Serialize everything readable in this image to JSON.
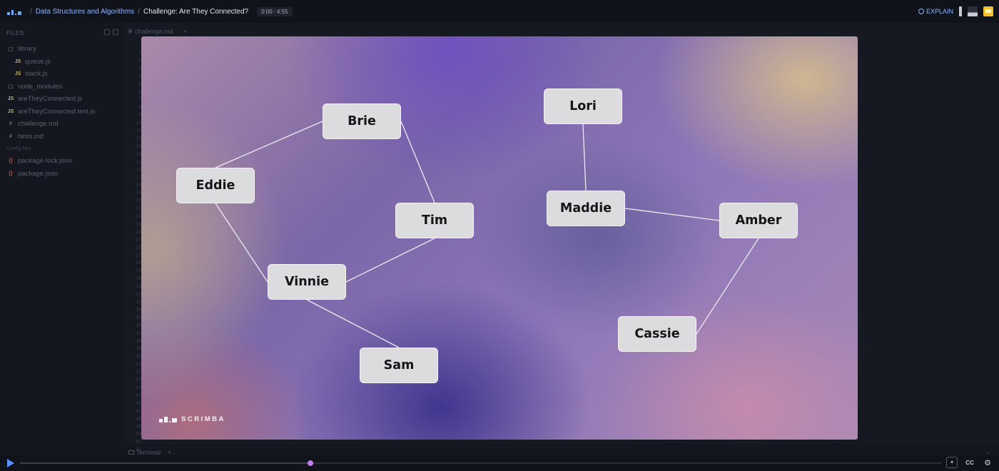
{
  "breadcrumb": {
    "course": "Data Structures and Algorithms",
    "lesson": "Challenge: Are They Connected?"
  },
  "timer": {
    "current": "0:00",
    "total": "4:55"
  },
  "topbar": {
    "explain_label": "EXPLAIN"
  },
  "sidebar": {
    "header": "FILES",
    "items": [
      {
        "label": "library",
        "type": "folder",
        "depth": 0
      },
      {
        "label": "queue.js",
        "type": "js",
        "depth": 1
      },
      {
        "label": "stack.js",
        "type": "js",
        "depth": 1
      },
      {
        "label": "node_modules",
        "type": "folder",
        "depth": 0
      },
      {
        "label": "areTheyConnected.js",
        "type": "js",
        "depth": 0
      },
      {
        "label": "areTheyConnected.test.js",
        "type": "js",
        "depth": 0
      },
      {
        "label": "challenge.md",
        "type": "md",
        "depth": 0
      },
      {
        "label": "hints.md",
        "type": "md",
        "depth": 0
      }
    ],
    "section_label": "Config files",
    "config_items": [
      {
        "label": "package-lock.json",
        "type": "json"
      },
      {
        "label": "package.json",
        "type": "json"
      }
    ]
  },
  "editor": {
    "tab_label": "challenge.md"
  },
  "slide": {
    "nodes": [
      "Brie",
      "Eddie",
      "Tim",
      "Vinnie",
      "Sam",
      "Lori",
      "Maddie",
      "Amber",
      "Cassie"
    ],
    "edges": [
      [
        "Eddie",
        "Brie"
      ],
      [
        "Brie",
        "Tim"
      ],
      [
        "Eddie",
        "Vinnie"
      ],
      [
        "Tim",
        "Vinnie"
      ],
      [
        "Vinnie",
        "Sam"
      ],
      [
        "Lori",
        "Maddie"
      ],
      [
        "Maddie",
        "Amber"
      ],
      [
        "Amber",
        "Cassie"
      ]
    ],
    "brand": "SCRIMBA"
  },
  "bottom": {
    "terminal_label": "Terminal",
    "cc_label": "CC"
  },
  "player": {
    "progress": 0.315
  },
  "colors": {
    "accent": "#5d8dff",
    "scrub_knob": "#c07cf0",
    "node_bg": "#dcdcdf"
  },
  "icons": [
    "scrimba-logo-icon",
    "explain-icon",
    "layout-icon",
    "slides-icon",
    "play-icon",
    "settings-icon"
  ]
}
